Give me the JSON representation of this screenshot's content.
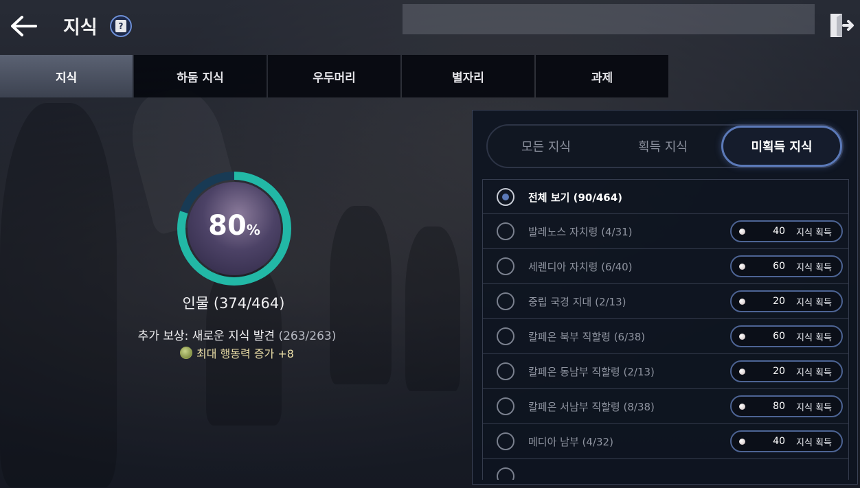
{
  "header": {
    "title": "지식"
  },
  "tabs": [
    {
      "label": "지식",
      "active": true
    },
    {
      "label": "하둠 지식",
      "active": false
    },
    {
      "label": "우두머리",
      "active": false
    },
    {
      "label": "별자리",
      "active": false
    },
    {
      "label": "과제",
      "active": false
    }
  ],
  "progress": {
    "percent_value": "80",
    "percent_symbol": "%",
    "fraction": 0.8,
    "category_label": "인물 (374/464)",
    "bonus_label": "추가 보상: 새로운 지식 발견",
    "bonus_count": "(263/263)",
    "reward_label": "최대 행동력 증가 +8"
  },
  "filter": {
    "options": [
      {
        "label": "모든 지식",
        "active": false
      },
      {
        "label": "획득 지식",
        "active": false
      },
      {
        "label": "미획득 지식",
        "active": true
      }
    ]
  },
  "list": {
    "rows": [
      {
        "label": "전체 보기 (90/464)",
        "selected": true
      },
      {
        "label": "발레노스 자치령 (4/31)",
        "points": "40",
        "badge_text": "지식 획득"
      },
      {
        "label": "세렌디아 자치령 (6/40)",
        "points": "60",
        "badge_text": "지식 획득"
      },
      {
        "label": "중립 국경 지대 (2/13)",
        "points": "20",
        "badge_text": "지식 획득"
      },
      {
        "label": "칼페온 북부 직할령 (6/38)",
        "points": "60",
        "badge_text": "지식 획득"
      },
      {
        "label": "칼페온 동남부 직할령 (2/13)",
        "points": "20",
        "badge_text": "지식 획득"
      },
      {
        "label": "칼페온 서남부 직할령 (8/38)",
        "points": "80",
        "badge_text": "지식 획득"
      },
      {
        "label": "메디아 남부 (4/32)",
        "points": "40",
        "badge_text": "지식 획득"
      }
    ]
  },
  "colors": {
    "progress_ring": "#22b8a6",
    "accent": "#5b79b8"
  },
  "icons": {
    "back": "arrow-left-icon",
    "help": "book-question-icon",
    "exit": "exit-door-icon",
    "reward": "stamina-medal-icon",
    "pearl": "pearl-icon"
  }
}
